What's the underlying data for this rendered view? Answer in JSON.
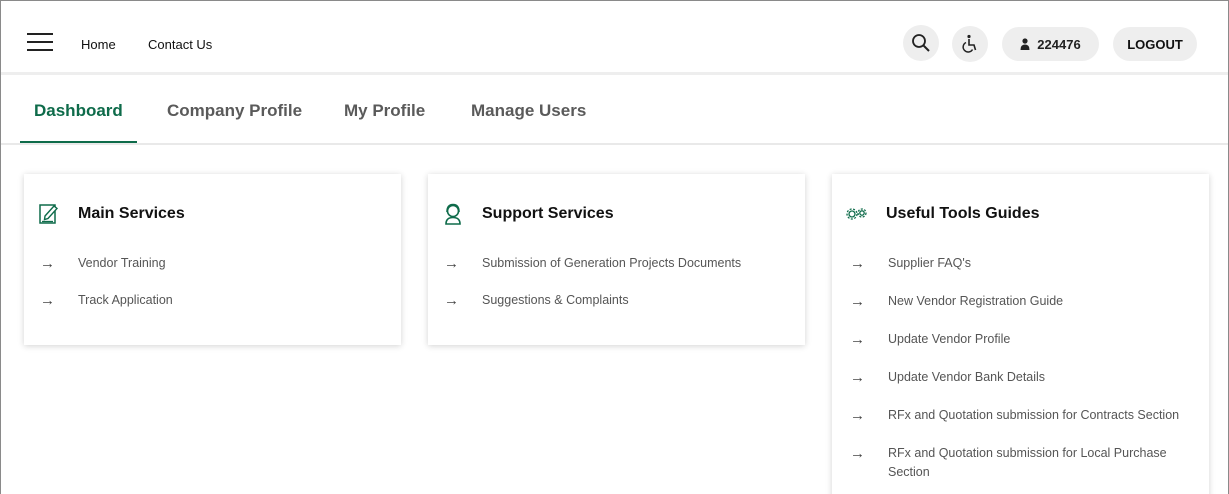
{
  "header": {
    "nav": [
      {
        "label": "Home"
      },
      {
        "label": "Contact Us"
      }
    ],
    "user_id": "224476",
    "logout_label": "LOGOUT",
    "icons": [
      "menu-icon",
      "search-icon",
      "accessibility-icon",
      "user-icon"
    ]
  },
  "tabs": [
    {
      "label": "Dashboard",
      "active": true
    },
    {
      "label": "Company Profile",
      "active": false
    },
    {
      "label": "My Profile",
      "active": false
    },
    {
      "label": "Manage Users",
      "active": false
    }
  ],
  "cards": {
    "main": {
      "title": "Main Services",
      "icon": "edit-document-icon",
      "items": [
        "Vendor Training",
        "Track Application"
      ]
    },
    "support": {
      "title": "Support Services",
      "icon": "support-agent-icon",
      "items": [
        "Submission of Generation Projects Documents",
        "Suggestions & Complaints"
      ]
    },
    "tools": {
      "title": "Useful Tools Guides",
      "icon": "gears-icon",
      "items": [
        "Supplier FAQ's",
        "New Vendor Registration Guide",
        "Update Vendor Profile",
        "Update Vendor Bank Details",
        "RFx and Quotation submission for Contracts Section",
        "RFx and Quotation submission for Local Purchase Section"
      ]
    }
  },
  "colors": {
    "accent": "#0e6b4a",
    "pill_bg": "#eeeeee"
  }
}
